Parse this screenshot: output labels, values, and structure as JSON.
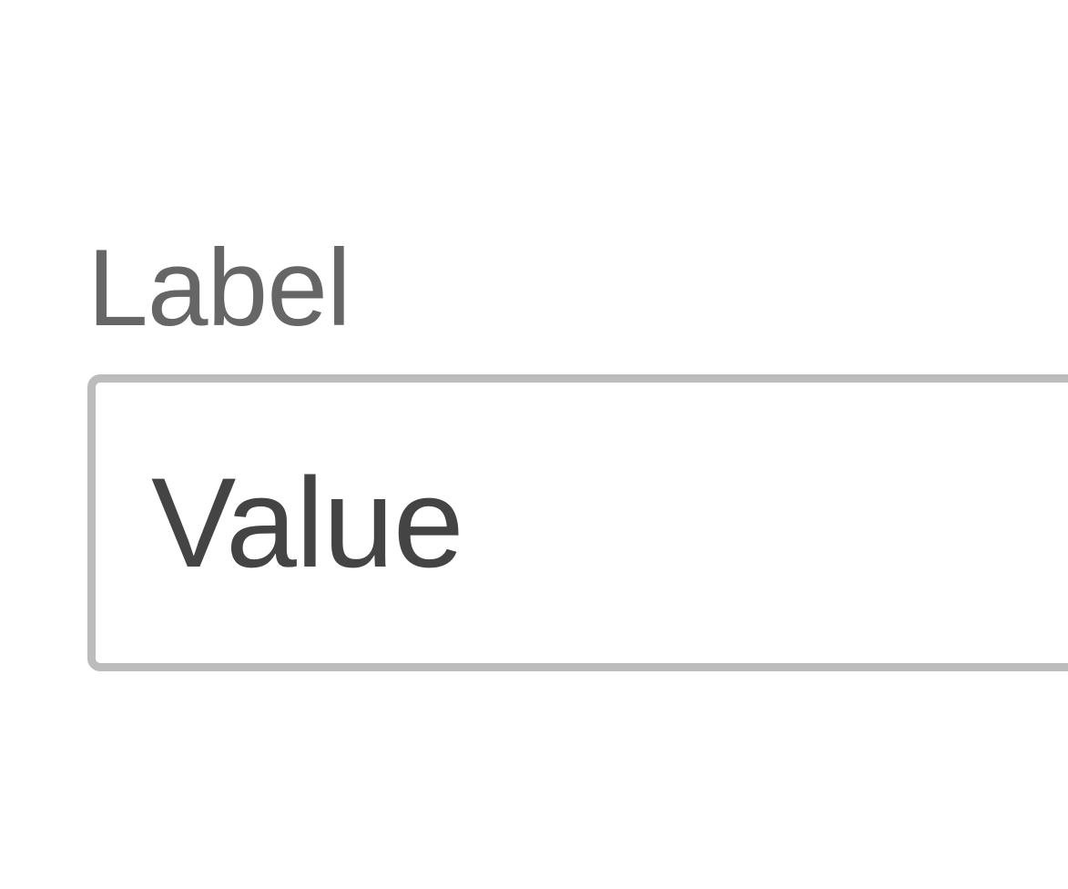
{
  "field": {
    "label": "Label",
    "value": "Value"
  },
  "colors": {
    "label_text": "#666666",
    "value_text": "#444444",
    "input_border": "#bcbcbc",
    "background": "#ffffff"
  }
}
